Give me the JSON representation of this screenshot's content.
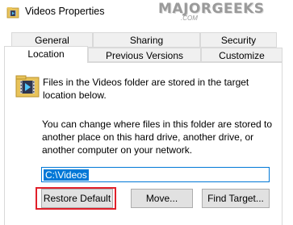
{
  "window": {
    "title": "Videos Properties",
    "watermark": "MAJORGEEKS",
    "watermark_sub": ".COM"
  },
  "tabs": {
    "row1": [
      {
        "label": "General"
      },
      {
        "label": "Sharing"
      },
      {
        "label": "Security"
      }
    ],
    "row2": [
      {
        "label": "Location",
        "active": true
      },
      {
        "label": "Previous Versions"
      },
      {
        "label": "Customize"
      }
    ]
  },
  "location": {
    "description": "Files in the Videos folder are stored in the target location below.",
    "help_text": "You can change where files in this folder are stored to another place on this hard drive, another drive, or another computer on your network.",
    "path_value": "C:\\Videos"
  },
  "buttons": {
    "restore_default": "Restore Default",
    "move": "Move...",
    "find_target": "Find Target..."
  },
  "icons": {
    "title": "videos-folder-icon",
    "content": "videos-folder-icon"
  },
  "colors": {
    "highlight": "#e0202a",
    "selection": "#0078d7"
  }
}
